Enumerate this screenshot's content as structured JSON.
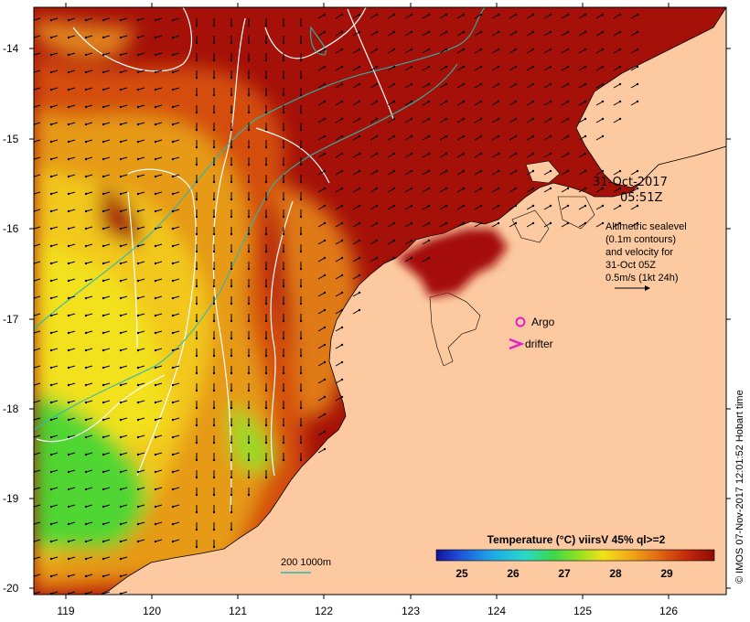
{
  "map": {
    "lon_ticks": [
      "119",
      "120",
      "121",
      "122",
      "123",
      "124",
      "125",
      "126"
    ],
    "lat_ticks": [
      "-14",
      "-15",
      "-16",
      "-17",
      "-18",
      "-19",
      "-20"
    ],
    "date": "31-Oct-2017",
    "time": "05:51Z",
    "altimetry_note": [
      "Altimetric sealevel",
      "(0.1m contours)",
      "and velocity for",
      "31-Oct 05Z",
      "0.5m/s (1kt 24h)"
    ],
    "argo_label": "Argo",
    "drifter_label": "drifter",
    "depth_legend": "200  1000m",
    "colorbar_title": "Temperature (°C) viirsV 45% ql>=2",
    "colorbar_ticks": [
      "25",
      "26",
      "27",
      "28",
      "29"
    ],
    "credit": "© IMOS 07-Nov-2017 12:01:52 Hobart time",
    "colors": {
      "land": "#fcc9a0",
      "ocean_hot": "#a51008",
      "ocean_mid": "#d44d10",
      "ocean_warm": "#e69a18",
      "ocean_yellow": "#f2e11a",
      "ocean_green": "#4fd630",
      "contour_white": "#ffffff",
      "isobath": "#2ab9b0",
      "argo": "#e61ecf"
    }
  }
}
